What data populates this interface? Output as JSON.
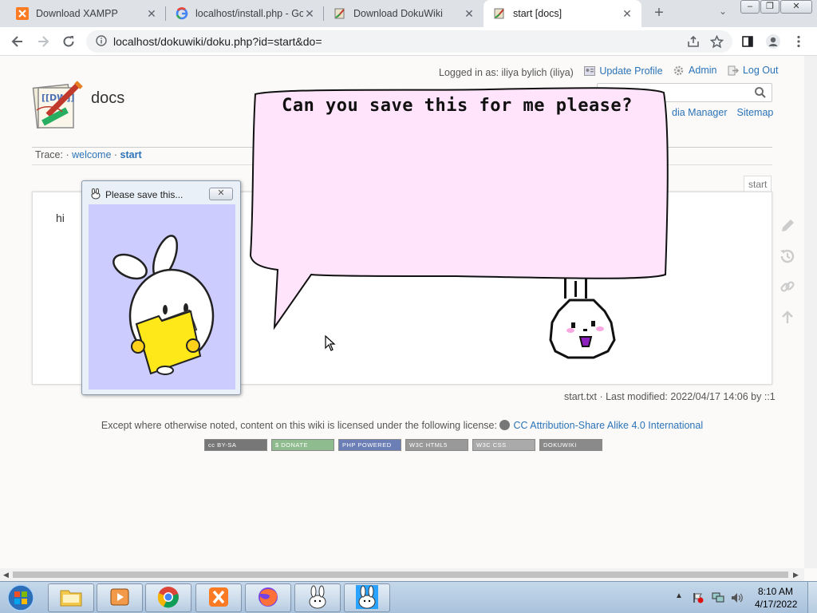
{
  "browser": {
    "tabs": [
      {
        "title": "Download XAMPP",
        "favicon": "xampp-icon",
        "active": false
      },
      {
        "title": "localhost/install.php - Go",
        "favicon": "google-icon",
        "active": false
      },
      {
        "title": "Download DokuWiki",
        "favicon": "dokuwiki-icon",
        "active": false
      },
      {
        "title": "start [docs]",
        "favicon": "dokuwiki-icon",
        "active": true
      }
    ],
    "url": "localhost/dokuwiki/doku.php?id=start&do="
  },
  "wiki": {
    "title": "docs",
    "logged_in": "Logged in as: iliya bylich (iliya)",
    "update_profile": "Update Profile",
    "admin": "Admin",
    "logout": "Log Out",
    "site_tools": {
      "media_manager": "dia Manager",
      "sitemap": "Sitemap"
    },
    "trace_label": "Trace:",
    "trace": [
      "welcome",
      "start"
    ],
    "page_id": "start",
    "content": "hi",
    "docinfo": "start.txt · Last modified: 2022/04/17 14:06 by ::1",
    "license_text": "Except where otherwise noted, content on this wiki is licensed under the following license:",
    "license_link": "CC Attribution-Share Alike 4.0 International",
    "badges": [
      {
        "text": "cc BY-SA",
        "color": "#777777"
      },
      {
        "text": "$ DONATE",
        "color": "#8fbc8f"
      },
      {
        "text": "PHP POWERED",
        "color": "#6b7fb6"
      },
      {
        "text": "W3C HTML5",
        "color": "#999999"
      },
      {
        "text": "W3C CSS",
        "color": "#aaaaaa"
      },
      {
        "text": "DOKUWIKI",
        "color": "#8a8a8a"
      }
    ]
  },
  "popup": {
    "title": "Please save this..."
  },
  "bubble": {
    "text": "Can you save this for me please?",
    "fill": "#ffe4fb"
  },
  "taskbar": {
    "items": [
      "explorer-icon",
      "media-player-icon",
      "chrome-icon",
      "xampp-icon",
      "firefox-icon",
      "bunny-icon",
      "bunny-icon"
    ],
    "time": "8:10 AM",
    "date": "4/17/2022"
  },
  "colors": {
    "link": "#2b73b7",
    "popup_bg": "#ccccff"
  }
}
